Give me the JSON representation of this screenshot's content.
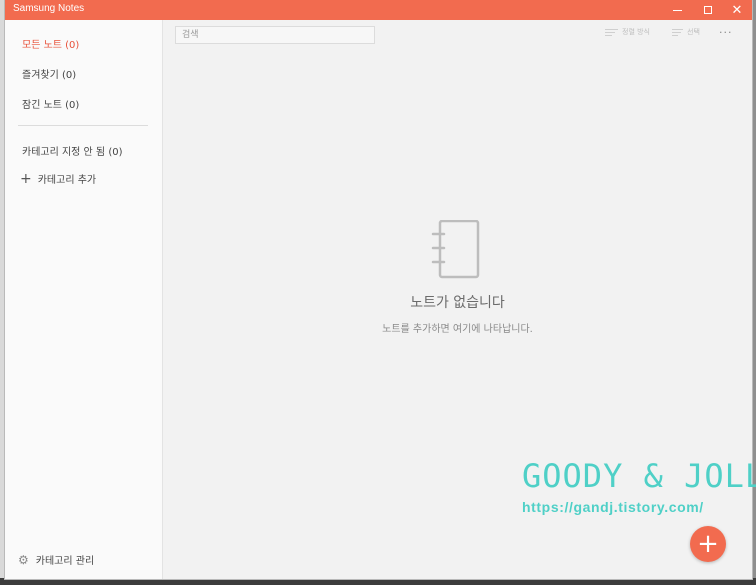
{
  "window": {
    "title": "Samsung Notes",
    "accent_color": "#f26b4f",
    "controls": {
      "minimize_icon": "minimize-icon",
      "maximize_icon": "maximize-icon",
      "close_icon": "close-icon",
      "close_glyph": "✕"
    }
  },
  "sidebar": {
    "all_notes": "모든 노트 (0)",
    "favorites": "즐겨찾기 (0)",
    "locked": "잠긴 노트 (0)",
    "uncategorized": "카테고리 지정 안 됨 (0)",
    "add_category_glyph": "+",
    "add_category": "카테고리 추가",
    "manage_glyph": "⚙",
    "manage_categories": "카테고리 관리"
  },
  "toolbar": {
    "search_placeholder": "검색",
    "sort_label": "정렬 방식",
    "select_label": "선택",
    "more_label": "···"
  },
  "empty_state": {
    "icon": "notebook-icon",
    "title": "노트가 없습니다",
    "subtitle": "노트를 추가하면 여기에 나타납니다."
  },
  "watermark": {
    "title": "GOODY & JOLLY",
    "url": "https://gandj.tistory.com/",
    "color": "#4fd0c7"
  },
  "fab": {
    "label": "+"
  }
}
